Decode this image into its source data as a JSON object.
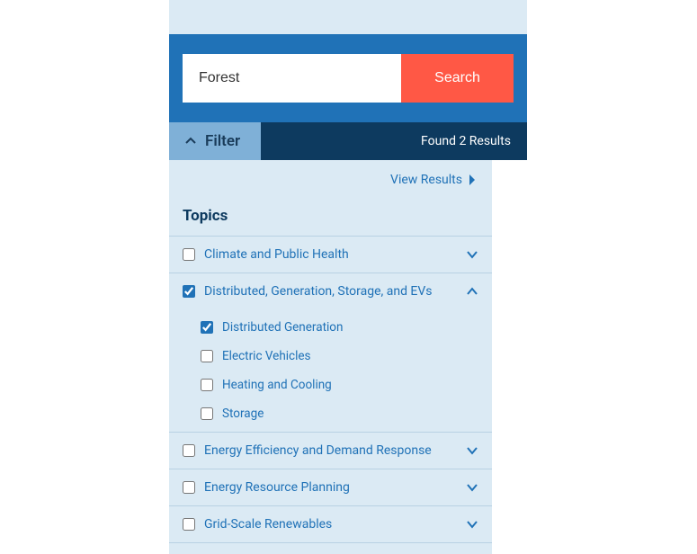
{
  "search": {
    "value": "Forest",
    "button_label": "Search"
  },
  "filter": {
    "label": "Filter",
    "results_text": "Found 2 Results",
    "view_results_label": "View Results"
  },
  "topics": {
    "heading": "Topics",
    "items": [
      {
        "label": "Climate and Public Health",
        "checked": false,
        "expanded": false
      },
      {
        "label": "Distributed, Generation, Storage, and EVs",
        "checked": true,
        "expanded": true,
        "children": [
          {
            "label": "Distributed Generation",
            "checked": true
          },
          {
            "label": "Electric Vehicles",
            "checked": false
          },
          {
            "label": "Heating and Cooling",
            "checked": false
          },
          {
            "label": "Storage",
            "checked": false
          }
        ]
      },
      {
        "label": "Energy Efficiency and Demand Response",
        "checked": false,
        "expanded": false
      },
      {
        "label": "Energy Resource Planning",
        "checked": false,
        "expanded": false
      },
      {
        "label": "Grid-Scale Renewables",
        "checked": false,
        "expanded": false
      }
    ]
  },
  "colors": {
    "primary_blue": "#2072b7",
    "dark_blue": "#0d3a5f",
    "light_blue": "#dbeaf4",
    "mid_blue": "#7fb0d7",
    "accent_red": "#ff5845"
  }
}
